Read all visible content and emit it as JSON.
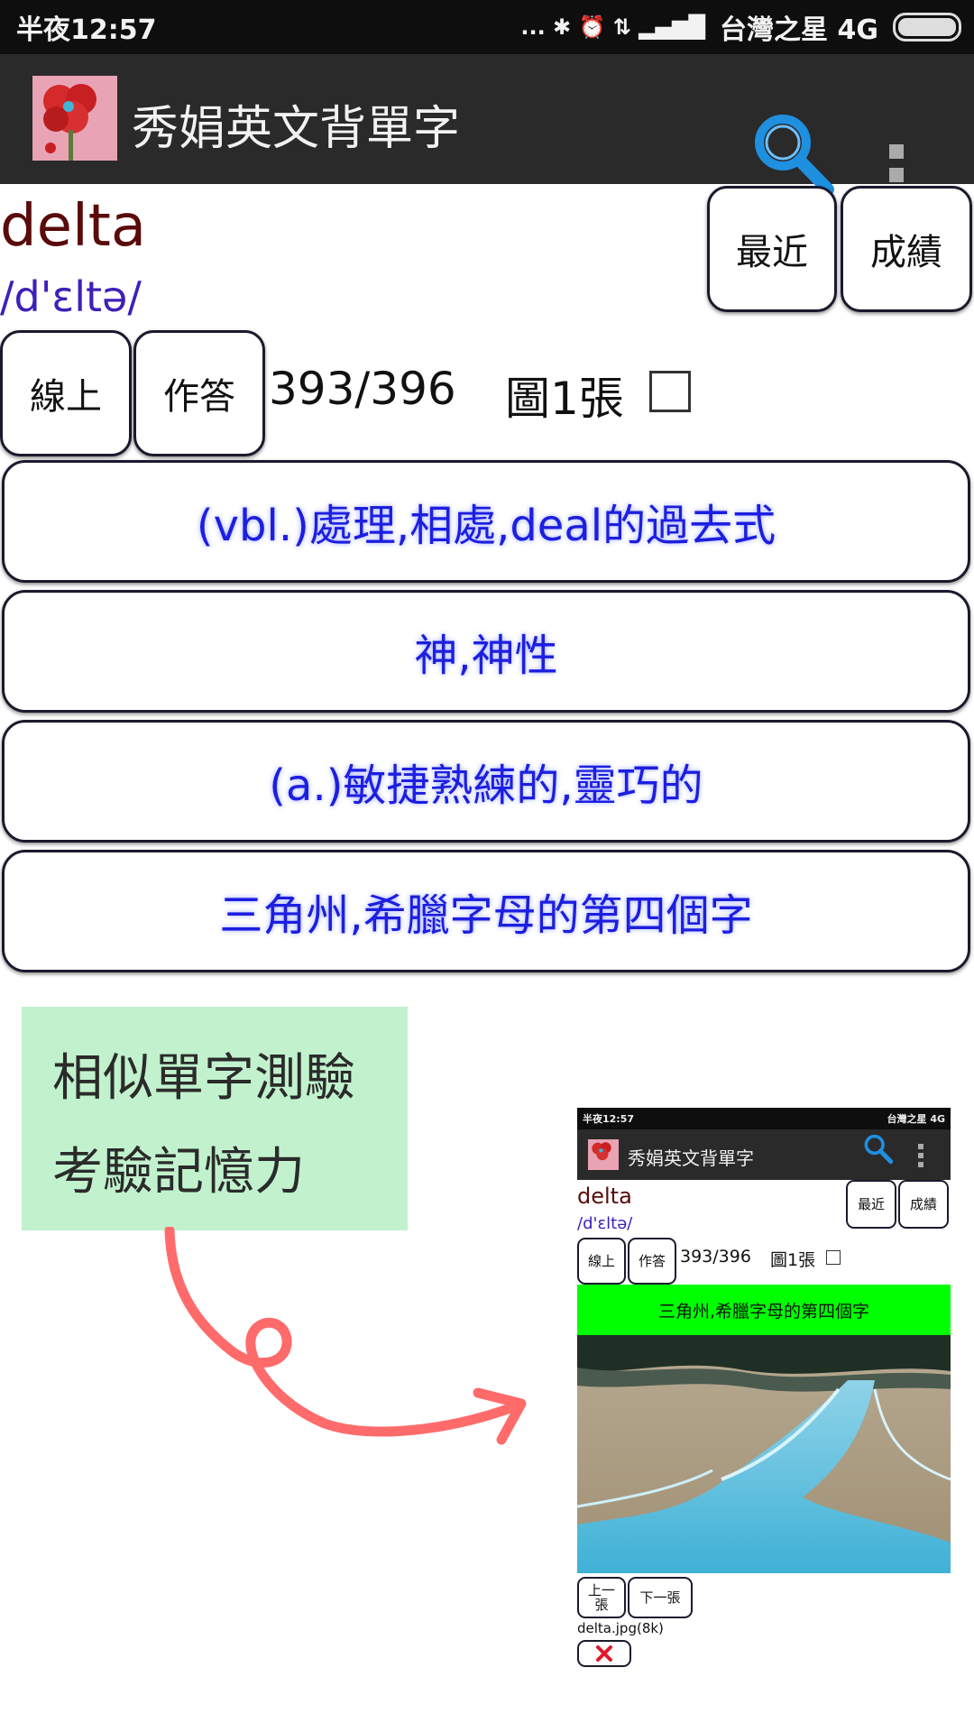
{
  "status_bar": {
    "time": "半夜12:57",
    "indicators": "... ✱ ⏰ ⇅ ▂▄▆█",
    "carrier": "台灣之星 4G"
  },
  "app_bar": {
    "title": "秀娟英文背單字",
    "icons": [
      "app-logo-icon",
      "search-icon",
      "overflow-menu-icon"
    ]
  },
  "word": {
    "text": "delta",
    "phonetic": "/d'ɛltə/"
  },
  "buttons": {
    "recent": "最近",
    "score": "成績",
    "online": "線上",
    "answer": "作答"
  },
  "progress": {
    "counter": "393/396",
    "images": "圖1張",
    "checked": false
  },
  "choices": [
    "(vbl.)處理,相處,deal的過去式",
    "神,神性",
    "(a.)敏捷熟練的,靈巧的",
    "三角州,希臘字母的第四個字"
  ],
  "note": {
    "line1": "相似單字測驗",
    "line2": "考驗記憶力"
  },
  "preview": {
    "time": "半夜12:57",
    "carrier": "台灣之星 4G",
    "title": "秀娟英文背單字",
    "word": "delta",
    "phonetic": "/d'ɛltə/",
    "recent": "最近",
    "score": "成績",
    "online": "線上",
    "answer": "作答",
    "counter": "393/396",
    "images": "圖1張",
    "correct_answer": "三角州,希臘字母的第四個字",
    "prev": "上一張",
    "next": "下一張",
    "file": "delta.jpg(8k)",
    "colors": {
      "answer_bg": "#00ff00"
    }
  },
  "colors": {
    "word": "#5a0b0b",
    "phonetic": "#3d20b8",
    "choice_text": "#1d1ee0",
    "note_bg": "#c1f2cd",
    "appbar_bg": "#2a2a2a"
  }
}
